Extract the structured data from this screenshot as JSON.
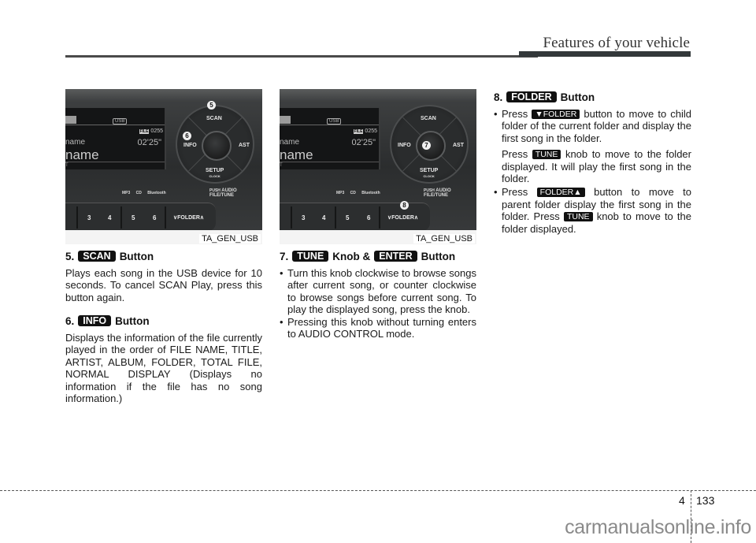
{
  "header": {
    "section_title": "Features of your vehicle"
  },
  "figures": [
    {
      "caption": "TA_GEN_USB",
      "callouts": [
        "5",
        "6"
      ],
      "display": {
        "source": "USB",
        "file_badge": "FILE",
        "file_number": "0255",
        "line1": "name",
        "time": "02'25\"",
        "line2": "name",
        "line3": "T"
      },
      "controls": {
        "top": "SCAN",
        "left": "INFO",
        "right": "AST",
        "bottom": "SETUP",
        "bottom_sub": "CLOCK",
        "push_small": "PUSH",
        "push_main": "AUDIO",
        "push_line2": "FILE/TUNE"
      },
      "brands": [
        "MP3",
        "CD",
        "Bluetooth"
      ],
      "presets": [
        "3",
        "4",
        "5",
        "6"
      ],
      "folder_button": "∨FOLDER∧"
    },
    {
      "caption": "TA_GEN_USB",
      "callouts": [
        "7",
        "8"
      ],
      "display": {
        "source": "USB",
        "file_badge": "FILE",
        "file_number": "0255",
        "line1": "name",
        "time": "02'25\"",
        "line2": "name",
        "line3": "T"
      },
      "controls": {
        "top": "SCAN",
        "left": "INFO",
        "right": "AST",
        "bottom": "SETUP",
        "bottom_sub": "CLOCK",
        "push_small": "PUSH",
        "push_main": "AUDIO",
        "push_line2": "FILE/TUNE"
      },
      "brands": [
        "MP3",
        "CD",
        "Bluetooth"
      ],
      "presets": [
        "3",
        "4",
        "5",
        "6"
      ],
      "folder_button": "∨FOLDER∧"
    }
  ],
  "sections": {
    "s5": {
      "number": "5.",
      "tag": "SCAN",
      "suffix": "Button",
      "text": "Plays each song in the USB device for 10 seconds. To cancel SCAN Play, press this button again."
    },
    "s6": {
      "number": "6.",
      "tag": "INFO",
      "suffix": "Button",
      "text": "Displays the information of the file currently played in the order of FILE NAME, TITLE, ARTIST, ALBUM, FOLDER, TOTAL FILE, NORMAL DISPLAY (Displays no information if the file has no song information.)"
    },
    "s7": {
      "number": "7.",
      "tag": "TUNE",
      "middle": "Knob &",
      "tag2": "ENTER",
      "suffix": "Button",
      "bullets": [
        "Turn this knob clockwise to browse songs after current song, or counter clockwise to browse songs before current song. To play the displayed song, press the knob.",
        "Pressing this knob without turning enters to AUDIO CONTROL mode."
      ]
    },
    "s8": {
      "number": "8.",
      "tag": "FOLDER",
      "suffix": "Button",
      "b1_pre": "Press",
      "b1_tag": "▼FOLDER",
      "b1_post": "button to move to child folder of the current folder and display the first song in the folder.",
      "b1_p2_pre": "Press",
      "b1_p2_tag": "TUNE",
      "b1_p2_post": "knob to move to the folder displayed. It will play the first song in the folder.",
      "b2_pre": "Press",
      "b2_tag": "FOLDER▲",
      "b2_mid": "button to move to parent folder display the first song in the folder. Press",
      "b2_tag2": "TUNE",
      "b2_post": "knob to move to the folder displayed."
    }
  },
  "footer": {
    "chapter": "4",
    "page": "133",
    "watermark": "carmanualsonline.info"
  }
}
